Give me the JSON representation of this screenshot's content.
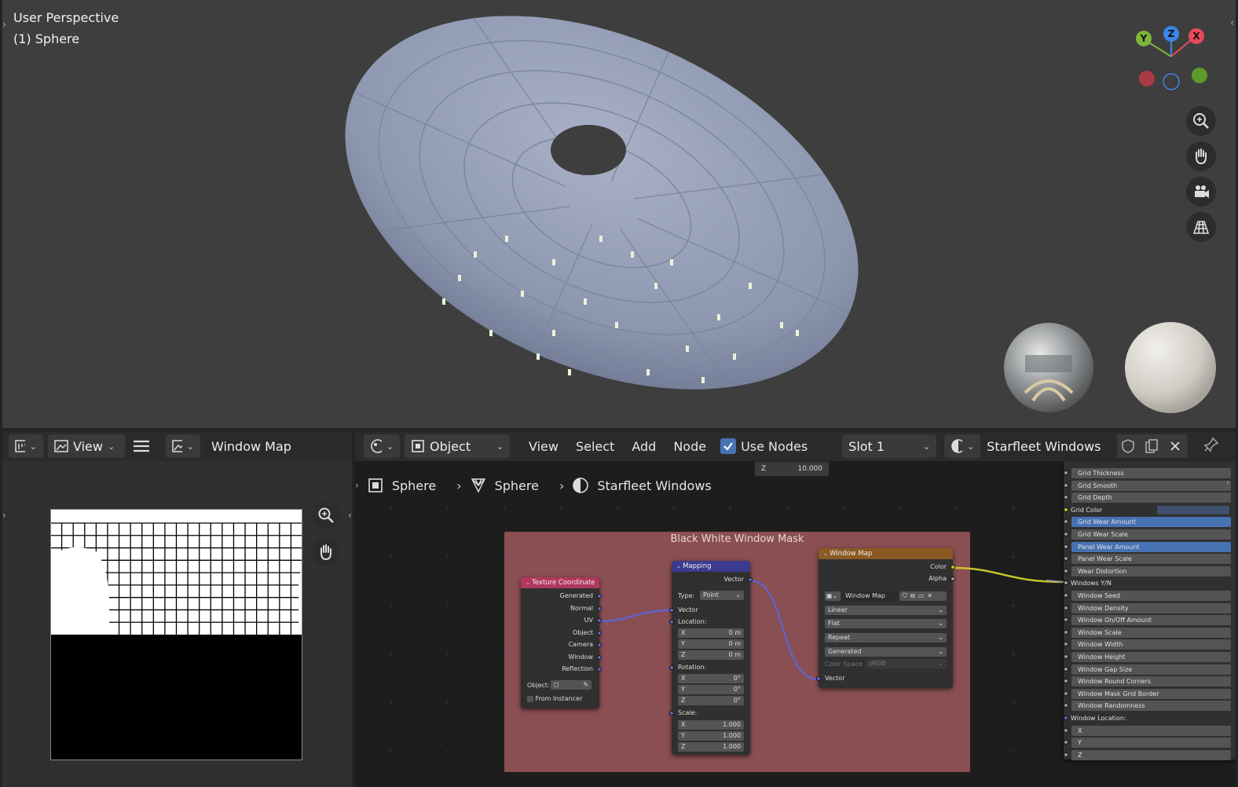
{
  "viewport": {
    "view_label": "User Perspective",
    "object_label": "(1) Sphere",
    "gizmo": {
      "x": "X",
      "y": "Y",
      "z": "Z"
    }
  },
  "image_editor": {
    "view_menu": "View",
    "image_name": "Window Map"
  },
  "node_editor": {
    "header": {
      "mode": "Object",
      "menus": [
        "View",
        "Select",
        "Add",
        "Node"
      ],
      "use_nodes_label": "Use Nodes",
      "slot": "Slot 1",
      "material": "Starfleet Windows"
    },
    "breadcrumb": [
      "Sphere",
      "Sphere",
      "Starfleet Windows"
    ],
    "z_field": {
      "label": "Z",
      "value": "10.000"
    },
    "frame_label": "Black White Window Mask",
    "texcoord": {
      "title": "Texture Coordinate",
      "outputs": [
        "Generated",
        "Normal",
        "UV",
        "Object",
        "Camera",
        "Window",
        "Reflection"
      ],
      "object_label": "Object:",
      "from_instancer": "From Instancer"
    },
    "mapping": {
      "title": "Mapping",
      "out_vector": "Vector",
      "type_label": "Type:",
      "type_value": "Point",
      "in_vector": "Vector",
      "location_label": "Location:",
      "location": [
        [
          "X",
          "0 m"
        ],
        [
          "Y",
          "0 m"
        ],
        [
          "Z",
          "0 m"
        ]
      ],
      "rotation_label": "Rotation:",
      "rotation": [
        [
          "X",
          "0°"
        ],
        [
          "Y",
          "0°"
        ],
        [
          "Z",
          "0°"
        ]
      ],
      "scale_label": "Scale:",
      "scale": [
        [
          "X",
          "1.000"
        ],
        [
          "Y",
          "1.000"
        ],
        [
          "Z",
          "1.000"
        ]
      ]
    },
    "window_map": {
      "title": "Window Map",
      "out_color": "Color",
      "out_alpha": "Alpha",
      "image": "Window Map",
      "interpolation": "Linear",
      "projection": "Flat",
      "extension": "Repeat",
      "source": "Generated",
      "color_space_label": "Color Space",
      "color_space": "sRGB",
      "in_vector": "Vector"
    },
    "side_inputs": [
      {
        "label": "Grid Thickness",
        "sel": false
      },
      {
        "label": "Grid Smooth",
        "sel": false
      },
      {
        "label": "Grid Depth",
        "sel": false
      },
      {
        "label": "Grid Color",
        "sel": false,
        "plain": true,
        "color": "#3f4f6e"
      },
      {
        "label": "Grid Wear Amount",
        "sel": true
      },
      {
        "label": "Grid Wear Scale",
        "sel": false
      },
      {
        "label": "Panel Wear Amount",
        "sel": true
      },
      {
        "label": "Panel Wear Scale",
        "sel": false
      },
      {
        "label": "Wear Distortion",
        "sel": false
      },
      {
        "label": "Windows Y/N",
        "sel": false,
        "plain": true
      },
      {
        "label": "Window Seed",
        "sel": false
      },
      {
        "label": "Window Density",
        "sel": false
      },
      {
        "label": "Window On/Off Amount",
        "sel": false
      },
      {
        "label": "Window Scale",
        "sel": false
      },
      {
        "label": "Window Width",
        "sel": false
      },
      {
        "label": "Window Height",
        "sel": false
      },
      {
        "label": "Window Gap Size",
        "sel": false
      },
      {
        "label": "Window Round Corners",
        "sel": false
      },
      {
        "label": "Window Mask Grid Border",
        "sel": false
      },
      {
        "label": "Window Randomness",
        "sel": false
      },
      {
        "label": "Window Location:",
        "sel": false,
        "plain": true
      },
      {
        "label": "X",
        "sel": false
      },
      {
        "label": "Y",
        "sel": false
      },
      {
        "label": "Z",
        "sel": false
      }
    ],
    "colors": {
      "frame": "#8a4f52",
      "texcoord_header": "#b0375f",
      "mapping_header": "#3b3b8f",
      "windowmap_header": "#8b5a23",
      "link_vector": "#6363c7",
      "link_color": "#c7c729"
    }
  }
}
